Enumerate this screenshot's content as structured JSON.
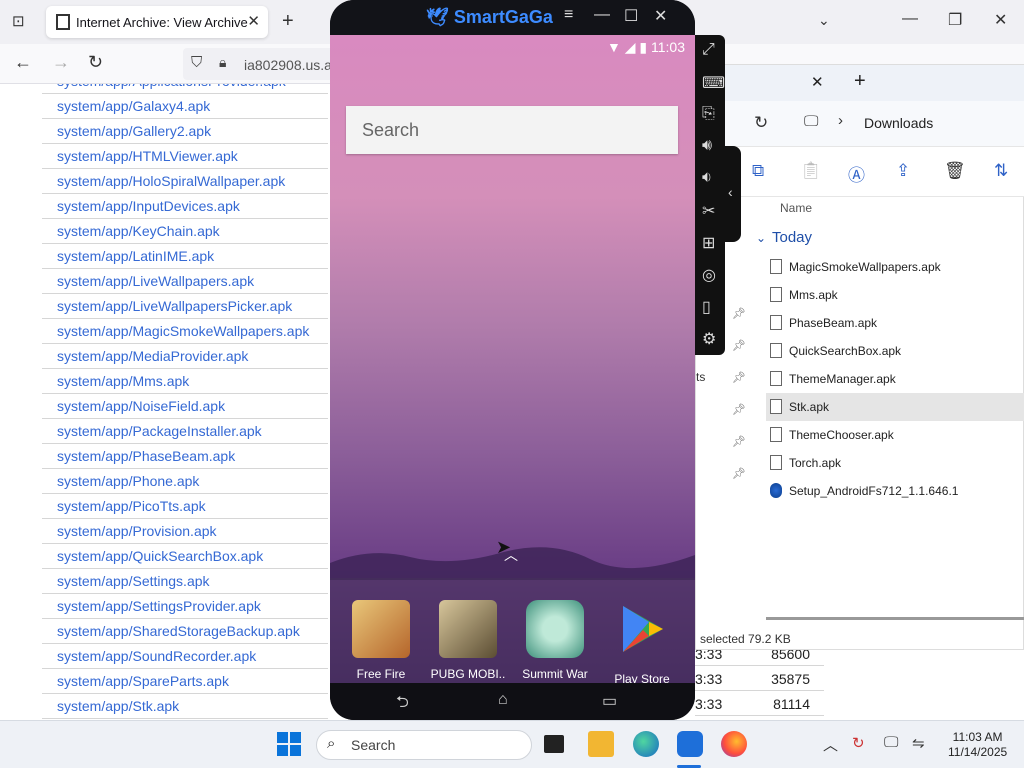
{
  "browser": {
    "tab_title": "Internet Archive: View Archive",
    "url": "ia802908.us.ar",
    "files": [
      "system/app/ApplicationsProvider.apk",
      "system/app/Galaxy4.apk",
      "system/app/Gallery2.apk",
      "system/app/HTMLViewer.apk",
      "system/app/HoloSpiralWallpaper.apk",
      "system/app/InputDevices.apk",
      "system/app/KeyChain.apk",
      "system/app/LatinIME.apk",
      "system/app/LiveWallpapers.apk",
      "system/app/LiveWallpapersPicker.apk",
      "system/app/MagicSmokeWallpapers.apk",
      "system/app/MediaProvider.apk",
      "system/app/Mms.apk",
      "system/app/NoiseField.apk",
      "system/app/PackageInstaller.apk",
      "system/app/PhaseBeam.apk",
      "system/app/Phone.apk",
      "system/app/PicoTts.apk",
      "system/app/Provision.apk",
      "system/app/QuickSearchBox.apk",
      "system/app/Settings.apk",
      "system/app/SettingsProvider.apk",
      "system/app/SharedStorageBackup.apk",
      "system/app/SoundRecorder.apk",
      "system/app/SpareParts.apk",
      "system/app/Stk.apk"
    ],
    "right_rows": [
      {
        "time": "3:33",
        "size": "85600"
      },
      {
        "time": "3:33",
        "size": "35875"
      },
      {
        "time": "3:33",
        "size": "81114"
      }
    ]
  },
  "explorer": {
    "location": "Downloads",
    "column_name": "Name",
    "group": "Today",
    "files": [
      "MagicSmokeWallpapers.apk",
      "Mms.apk",
      "PhaseBeam.apk",
      "QuickSearchBox.apk",
      "ThemeManager.apk",
      "Stk.apk",
      "ThemeChooser.apk",
      "Torch.apk",
      "Setup_AndroidFs712_1.1.646.1"
    ],
    "selected_file": "Stk.apk",
    "status": "selected  79.2 KB",
    "side_fragment": "ts"
  },
  "emulator": {
    "brand": "SmartGaGa",
    "time": "11:03",
    "search_placeholder": "Search",
    "apps": [
      {
        "label": "Free Fire",
        "color": "#c9882e"
      },
      {
        "label": "PUBG MOBI..",
        "color": "#7b6a45"
      },
      {
        "label": "Summit War",
        "color": "#7ec9b0"
      },
      {
        "label": "Play Store",
        "color": "#ffffff"
      }
    ]
  },
  "taskbar": {
    "search_label": "Search",
    "time": "11:03 AM",
    "date": "11/14/2025"
  }
}
